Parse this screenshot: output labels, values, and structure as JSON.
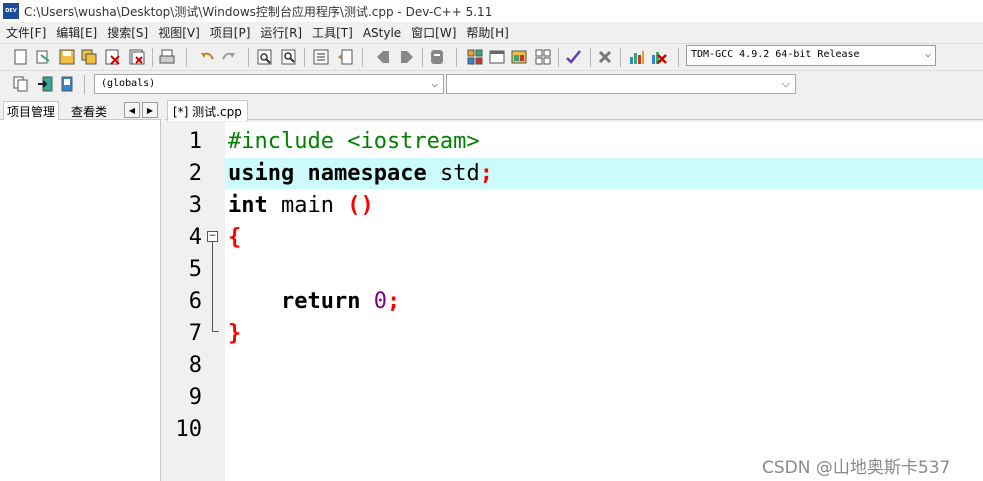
{
  "window": {
    "logo_text": "DEV",
    "title": "C:\\Users\\wusha\\Desktop\\测试\\Windows控制台应用程序\\测试.cpp - Dev-C++ 5.11"
  },
  "menu": {
    "items": [
      "文件[F]",
      "编辑[E]",
      "搜索[S]",
      "视图[V]",
      "项目[P]",
      "运行[R]",
      "工具[T]",
      "AStyle",
      "窗口[W]",
      "帮助[H]"
    ]
  },
  "toolbar": {
    "compiler_selected": "TDM-GCC 4.9.2 64-bit Release",
    "scope_selected": "(globals)",
    "member_selected": ""
  },
  "left_panel": {
    "tab_project": "项目管理",
    "tab_classes": "查看类",
    "arrow_left": "◀",
    "arrow_right": "▶"
  },
  "editor": {
    "file_tab": "[*] 测试.cpp",
    "line_numbers": [
      "1",
      "2",
      "3",
      "4",
      "5",
      "6",
      "7",
      "8",
      "9",
      "10"
    ],
    "active_line": 2,
    "code": {
      "l1": "#include <iostream>",
      "l2_kw1": "using",
      "l2_kw2": "namespace",
      "l2_id": "std",
      "l2_sym": ";",
      "l3_kw": "int",
      "l3_id": "main",
      "l3_sym": "()",
      "l4_sym": "{",
      "l6_kw": "return",
      "l6_num": "0",
      "l6_sym": ";",
      "l7_sym": "}"
    }
  },
  "watermark": "CSDN @山地奥斯卡537",
  "colors": {
    "active_line": "#ccfbfb",
    "preprocessor": "#008000",
    "symbol": "#ff0000",
    "number": "#800080"
  }
}
